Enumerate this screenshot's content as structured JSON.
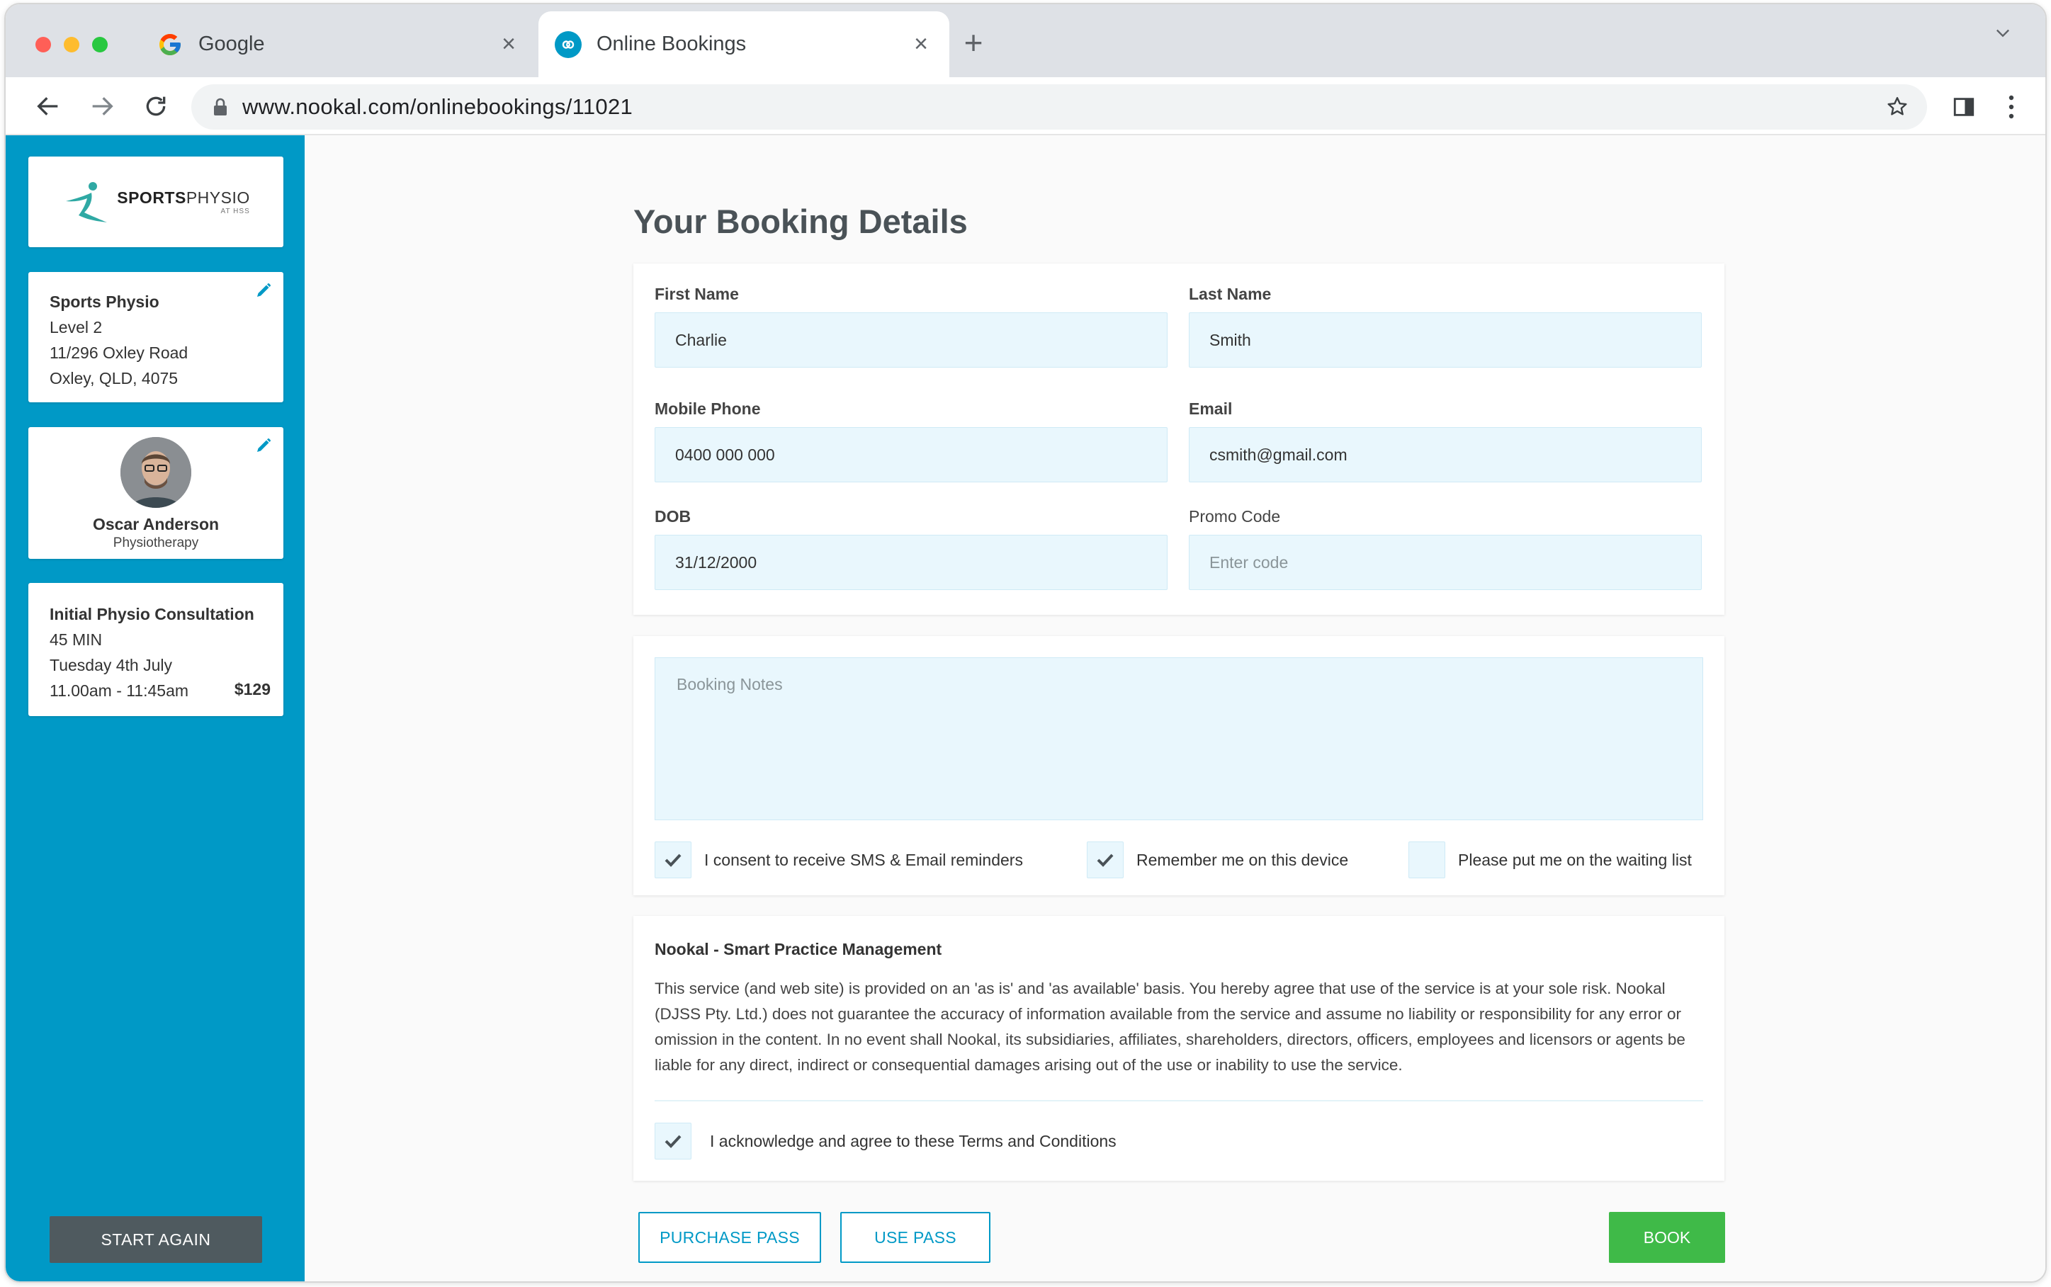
{
  "browser": {
    "tabs": [
      {
        "title": "Google",
        "icon": "google-g-icon",
        "active": false
      },
      {
        "title": "Online Bookings",
        "icon": "nookal-infinity-icon",
        "active": true
      }
    ],
    "url": "www.nookal.com/onlinebookings/11021"
  },
  "sidebar": {
    "logo": {
      "brand_bold": "SPORTS",
      "brand_light": "PHYSIO",
      "sub": "AT HSS"
    },
    "location": {
      "name": "Sports Physio",
      "line1": "Level 2",
      "line2": "11/296 Oxley Road",
      "line3": "Oxley, QLD, 4075"
    },
    "practitioner": {
      "name": "Oscar Anderson",
      "role": "Physiotherapy"
    },
    "service": {
      "name": "Initial Physio Consultation",
      "duration": "45 MIN",
      "date": "Tuesday 4th July",
      "time": "11.00am - 11:45am",
      "price": "$129"
    },
    "start_again_label": "START AGAIN"
  },
  "main": {
    "title": "Your Booking Details",
    "fields": {
      "first_name": {
        "label": "First Name",
        "value": "Charlie"
      },
      "last_name": {
        "label": "Last Name",
        "value": "Smith"
      },
      "mobile": {
        "label": "Mobile Phone",
        "value": "0400 000 000"
      },
      "email": {
        "label": "Email",
        "value": "csmith@gmail.com"
      },
      "dob": {
        "label": "DOB",
        "value": "31/12/2000"
      },
      "promo": {
        "label": "Promo Code",
        "placeholder": "Enter code"
      }
    },
    "notes": {
      "placeholder": "Booking Notes"
    },
    "checkboxes": [
      {
        "label": "I consent to receive SMS & Email reminders",
        "checked": true
      },
      {
        "label": "Remember me on this device",
        "checked": true
      },
      {
        "label": "Please put me on the waiting list",
        "checked": false
      }
    ],
    "terms": {
      "title": "Nookal - Smart Practice Management",
      "body": "This service (and web site) is provided on an 'as is' and 'as available' basis. You hereby agree that use of the service is at your sole risk. Nookal (DJSS Pty. Ltd.) does not guarantee the accuracy of information available from the service and assume no liability or responsibility for any error or omission in the content. In no event shall Nookal, its subsidiaries, affiliates, shareholders, directors, officers, employees and licensors or agents be liable for any direct, indirect or consequential damages arising out of the use or inability to use the service.",
      "ack_label": "I acknowledge and agree to these Terms and Conditions",
      "ack_checked": true
    },
    "buttons": {
      "purchase_pass": "PURCHASE PASS",
      "use_pass": "USE PASS",
      "book": "BOOK"
    }
  },
  "colors": {
    "accent": "#0099c6",
    "book": "#3fba48",
    "input_bg": "#e9f7fd",
    "start_again": "#4f5a5f"
  }
}
